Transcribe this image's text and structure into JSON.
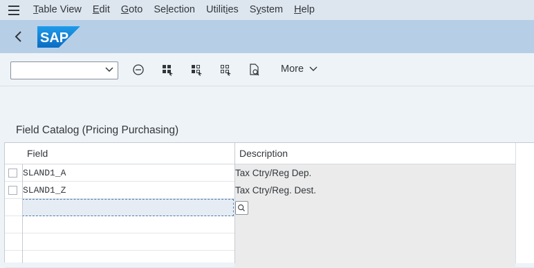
{
  "menu": {
    "items": [
      {
        "pre": "",
        "u": "T",
        "post": "able View"
      },
      {
        "pre": "",
        "u": "E",
        "post": "dit"
      },
      {
        "pre": "",
        "u": "G",
        "post": "oto"
      },
      {
        "pre": "Se",
        "u": "l",
        "post": "ection"
      },
      {
        "pre": "Utilit",
        "u": "i",
        "post": "es"
      },
      {
        "pre": "S",
        "u": "y",
        "post": "stem"
      },
      {
        "pre": "",
        "u": "H",
        "post": "elp"
      }
    ]
  },
  "shell": {
    "logo_text": "SAP"
  },
  "toolbar": {
    "combo_value": "",
    "more_label": "More"
  },
  "catalog": {
    "title": "Field Catalog (Pricing Purchasing)",
    "columns": {
      "field": "Field",
      "description": "Description"
    },
    "rows": [
      {
        "field": "SLAND1_A",
        "description": "Tax Ctry/Reg Dep."
      },
      {
        "field": "SLAND1_Z",
        "description": "Tax Ctry/Reg. Dest."
      }
    ]
  },
  "colors": {
    "menubar_bg": "#dde6ef",
    "shellbar_bg": "#b6cfe7",
    "sap_logo_blue": "#1b8bd8",
    "page_bg": "#eef3f8"
  }
}
